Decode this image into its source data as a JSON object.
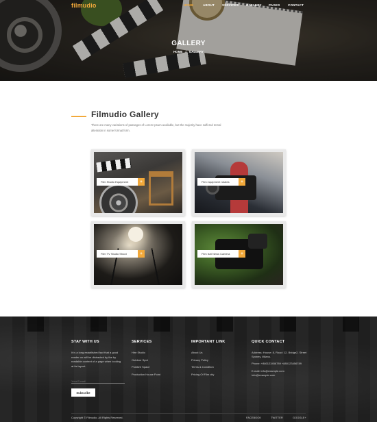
{
  "brand": {
    "logo": "filmudio",
    "accent": "#f2a93b"
  },
  "nav": {
    "items": [
      "HOME",
      "ABOUT",
      "SERVICES",
      "GALLERY",
      "PAGES",
      "CONTACT"
    ]
  },
  "hero": {
    "title": "GALLERY",
    "breadcrumb": [
      "HOME",
      "/",
      "GALLERY"
    ]
  },
  "section": {
    "title": "Filmudio Gallery",
    "description": "There are many variations of passages of Lorem Ipsum available, but the majority have suffered ternal alteration in some format form."
  },
  "gallery": [
    {
      "caption": "Film Studio Equipment",
      "icon": "plus-icon"
    },
    {
      "caption": "Film equipment rotates",
      "icon": "plus-icon"
    },
    {
      "caption": "Film TV Studio Shoot",
      "icon": "plus-icon"
    },
    {
      "caption": "Film Ishi News Camera",
      "icon": "plus-icon"
    }
  ],
  "footer": {
    "stay": {
      "heading": "STAY WITH US",
      "text": "It is a long established fact that a good reader on will be distracted by the by readable content of a page when looking at its layout.",
      "email_placeholder": "Your E-mail",
      "button": "Subscribe"
    },
    "services": {
      "heading": "SERVICES",
      "items": [
        "Hire Studio",
        "Outdoor Spot",
        "Positive Space",
        "Production House Point"
      ]
    },
    "links": {
      "heading": "IMPORTANT LINK",
      "items": [
        "About Us",
        "Privacy Policy",
        "Terms & Condition",
        "Pricing Of Film city"
      ]
    },
    "contact": {
      "heading": "QUICK CONTACT",
      "address": "Address: House: 8, Road: 12, Bridge2, Street Sydney, Milano.",
      "phone": "Phone: +880123456789 +880123456789",
      "email": "E-mail: info@example.com",
      "email2": "info@example.com"
    },
    "copyright": "Copyright © Filmudio. All Rights Reserved.",
    "social": [
      "FACEBOOK",
      "TWITTER",
      "GOOGLE+"
    ]
  }
}
